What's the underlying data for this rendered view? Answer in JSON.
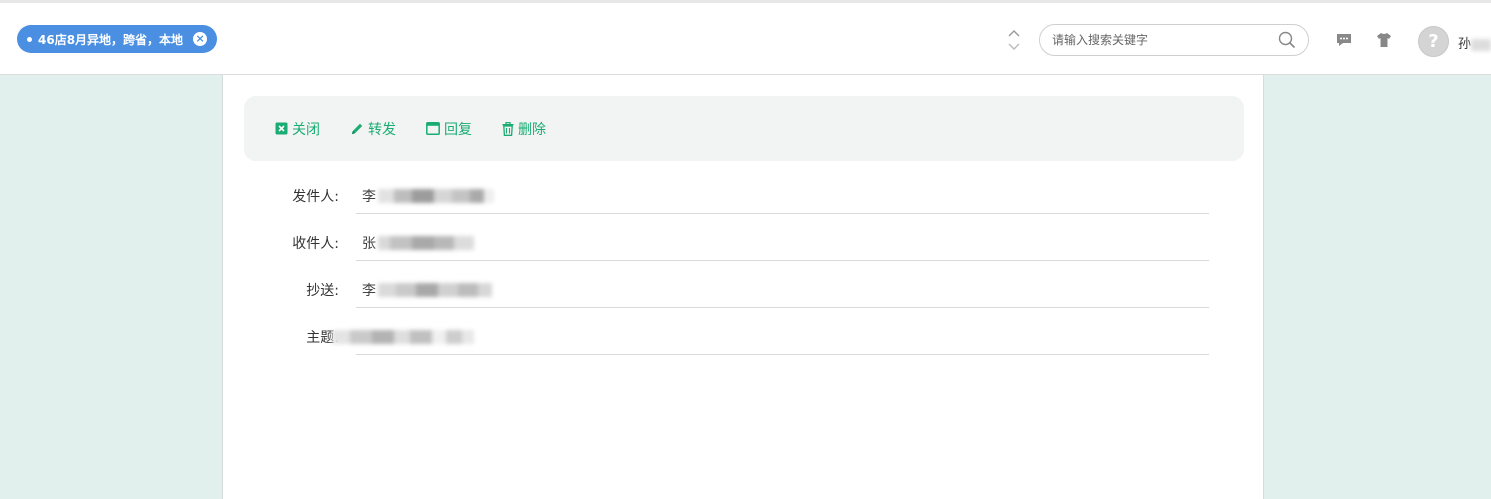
{
  "tab": {
    "label": "46店8月异地，跨省，本地",
    "close_glyph": "×"
  },
  "search": {
    "placeholder": "请输入搜索关键字"
  },
  "user": {
    "name": "孙",
    "avatar_glyph": "?"
  },
  "toolbar": {
    "close_label": "关闭",
    "forward_label": "转发",
    "reply_label": "回复",
    "delete_label": "删除"
  },
  "mail": {
    "sender_label": "发件人:",
    "sender_value": "李",
    "recipient_label": "收件人:",
    "recipient_value": "张",
    "cc_label": "抄送:",
    "cc_value": "李",
    "subject_label": "主题:",
    "subject_value": ""
  },
  "colors": {
    "accent_green": "#1aad73",
    "tab_blue": "#4a8fe2",
    "page_bg": "#e1f0ec"
  },
  "icons": [
    "close-box-icon",
    "pencil-icon",
    "window-icon",
    "trash-icon",
    "search-icon",
    "chat-icon",
    "shirt-icon",
    "chevron-up-icon",
    "chevron-down-icon"
  ]
}
